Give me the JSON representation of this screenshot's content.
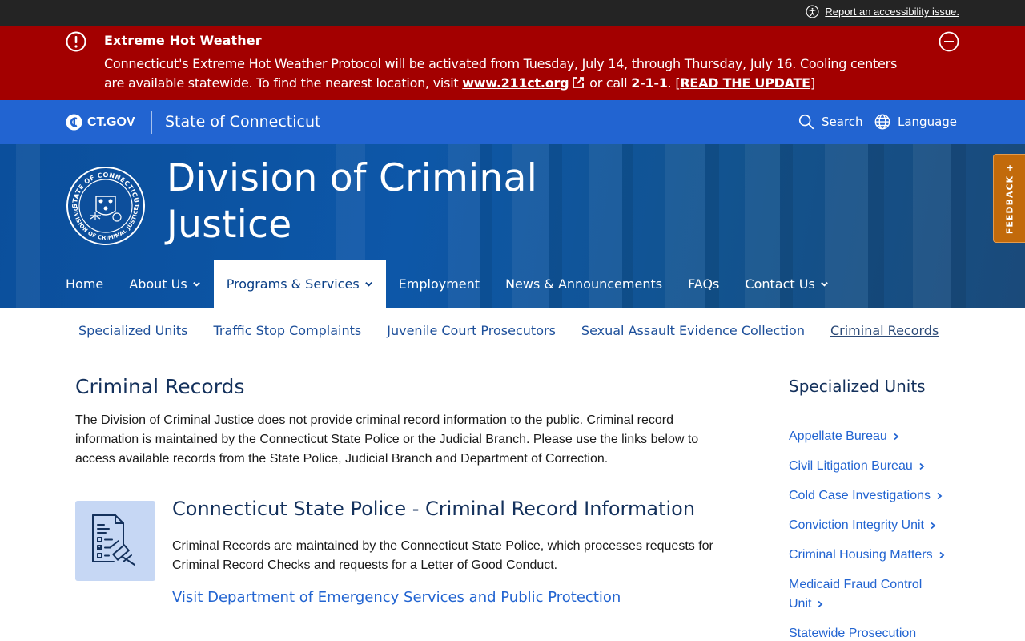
{
  "utility": {
    "accessibility_link": "Report an accessibility issue."
  },
  "alert": {
    "title": "Extreme Hot Weather",
    "body_part1": "Connecticut's Extreme Hot Weather Protocol will be activated from Tuesday, July 14, through Thursday, July 16. Cooling centers are available statewide. To find the nearest location, visit ",
    "link_text": "www.211ct.org",
    "body_part2": " or call ",
    "phone": "2-1-1",
    "body_part3": ". [",
    "update_link": "READ THE UPDATE",
    "body_part4": "]"
  },
  "site_header": {
    "logo_text": "CT.GOV",
    "state_name": "State of Connecticut",
    "search_label": "Search",
    "language_label": "Language"
  },
  "hero": {
    "agency_title": "Division of Criminal Justice",
    "seal_text_top": "STATE OF CONNECTICUT",
    "seal_text_bottom": "DIVISION OF CRIMINAL JUSTICE"
  },
  "main_nav": [
    {
      "label": "Home",
      "has_dropdown": false
    },
    {
      "label": "About Us",
      "has_dropdown": true
    },
    {
      "label": "Programs & Services",
      "has_dropdown": true,
      "active": true
    },
    {
      "label": "Employment",
      "has_dropdown": false
    },
    {
      "label": "News & Announcements",
      "has_dropdown": false
    },
    {
      "label": "FAQs",
      "has_dropdown": false
    },
    {
      "label": "Contact Us",
      "has_dropdown": true
    }
  ],
  "sub_nav": [
    {
      "label": "Specialized Units"
    },
    {
      "label": "Traffic Stop Complaints"
    },
    {
      "label": "Juvenile Court Prosecutors"
    },
    {
      "label": "Sexual Assault Evidence Collection"
    },
    {
      "label": "Criminal Records",
      "current": true
    }
  ],
  "main": {
    "title": "Criminal Records",
    "intro": "The Division of Criminal Justice does not provide criminal record information to the public. Criminal record information is maintained by the Connecticut State Police or the Judicial Branch. Please use the links below to access available records from the State Police, Judicial Branch and Department of Correction.",
    "card": {
      "title": "Connecticut State Police - Criminal Record Information",
      "text": "Criminal Records are maintained by the Connecticut State Police, which processes requests for Criminal Record Checks and requests for a Letter of Good Conduct.",
      "link": "Visit Department of Emergency Services and Public Protection"
    }
  },
  "sidebar": {
    "title": "Specialized Units",
    "items": [
      {
        "label": "Appellate Bureau"
      },
      {
        "label": "Civil Litigation Bureau"
      },
      {
        "label": "Cold Case Investigations"
      },
      {
        "label": "Conviction Integrity Unit"
      },
      {
        "label": "Criminal Housing Matters"
      },
      {
        "label": "Medicaid Fraud Control Unit"
      },
      {
        "label": "Statewide Prosecution"
      }
    ]
  },
  "feedback": {
    "label": "FEEDBACK +"
  },
  "colors": {
    "utility_bar": "#242424",
    "alert_red": "#a30000",
    "header_blue": "#2264d1",
    "hero_blue": "#0d57a8",
    "link_blue": "#2264d1",
    "title_navy": "#14315c",
    "feedback_orange": "#c26a0b",
    "card_icon_bg": "#c6d7f4"
  }
}
